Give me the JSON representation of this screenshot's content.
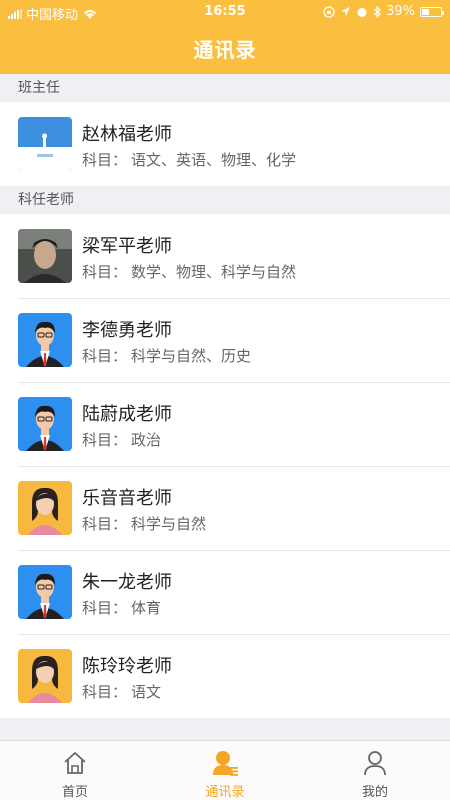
{
  "status_bar": {
    "carrier": "中国移动",
    "time": "16:55",
    "battery": "39%"
  },
  "header": {
    "title": "通讯录"
  },
  "sections": [
    {
      "label": "班主任",
      "teachers": [
        {
          "name": "赵林福老师",
          "subject_prefix": "科目：",
          "subjects": "语文、英语、物理、化学",
          "avatar": "app-icon-avatar"
        }
      ]
    },
    {
      "label": "科任老师",
      "teachers": [
        {
          "name": "梁军平老师",
          "subject_prefix": "科目：",
          "subjects": "数学、物理、科学与自然",
          "avatar": "photo-avatar"
        },
        {
          "name": "李德勇老师",
          "subject_prefix": "科目：",
          "subjects": "科学与自然、历史",
          "avatar": "male-avatar"
        },
        {
          "name": "陆蔚成老师",
          "subject_prefix": "科目：",
          "subjects": "政治",
          "avatar": "male-avatar"
        },
        {
          "name": "乐音音老师",
          "subject_prefix": "科目：",
          "subjects": "科学与自然",
          "avatar": "female-avatar"
        },
        {
          "name": "朱一龙老师",
          "subject_prefix": "科目：",
          "subjects": "体育",
          "avatar": "male-avatar"
        },
        {
          "name": "陈玲玲老师",
          "subject_prefix": "科目：",
          "subjects": "语文",
          "avatar": "female-avatar"
        }
      ]
    }
  ],
  "tabbar": {
    "tabs": [
      {
        "label": "首页",
        "icon": "home-icon",
        "active": false
      },
      {
        "label": "通讯录",
        "icon": "contacts-icon",
        "active": true
      },
      {
        "label": "我的",
        "icon": "profile-icon",
        "active": false
      }
    ]
  },
  "colors": {
    "accent": "#fbbf3f",
    "active_tab": "#f5a623"
  }
}
